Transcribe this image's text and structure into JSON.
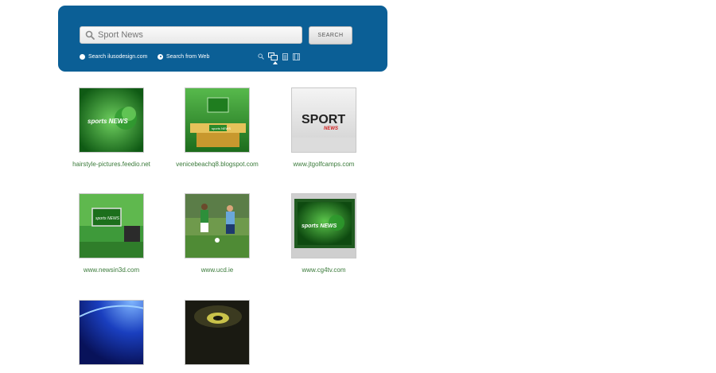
{
  "search": {
    "placeholder": "Sport News",
    "button_label": "SEARCH",
    "scope_options": [
      {
        "label": "Search ilusodesign.com",
        "selected": false
      },
      {
        "label": "Search from Web",
        "selected": true
      }
    ],
    "modes": [
      {
        "icon": "search-icon",
        "selected": false
      },
      {
        "icon": "image-icon",
        "selected": true
      },
      {
        "icon": "document-icon",
        "selected": false
      },
      {
        "icon": "video-icon",
        "selected": false
      }
    ]
  },
  "results": [
    {
      "caption": "hairstyle-pictures.feedio.net",
      "thumb_text": "sports NEWS",
      "thumb_kind": "logo-green"
    },
    {
      "caption": "venicebeachq8.blogspot.com",
      "thumb_text": "sports NEWS",
      "thumb_kind": "studio-desk"
    },
    {
      "caption": "www.jtgolfcamps.com",
      "thumb_text": "SPORT",
      "thumb_subtext": "NEWS",
      "thumb_kind": "sport-news-grey"
    },
    {
      "caption": "www.newsin3d.com",
      "thumb_text": "sports NEWS",
      "thumb_kind": "studio-screen"
    },
    {
      "caption": "www.ucd.ie",
      "thumb_text": "",
      "thumb_kind": "football-players"
    },
    {
      "caption": "www.cg4tv.com",
      "thumb_text": "sports NEWS",
      "thumb_kind": "logo-screen"
    },
    {
      "caption": "",
      "thumb_text": "",
      "thumb_kind": "blue-rays"
    },
    {
      "caption": "",
      "thumb_text": "",
      "thumb_kind": "dark-yellow"
    }
  ],
  "colors": {
    "panel": "#0b5f96",
    "caption": "#3a7a3a",
    "thumb_green": "#2e8b2e"
  }
}
